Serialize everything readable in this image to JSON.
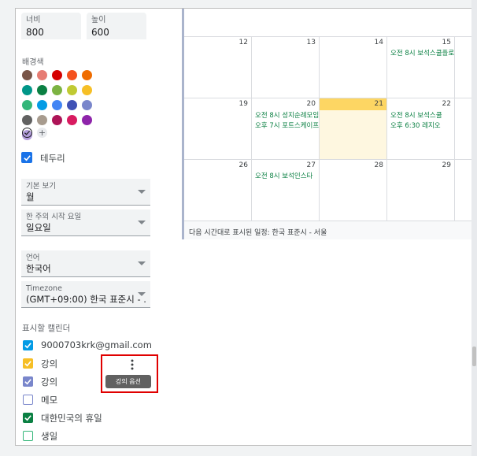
{
  "size": {
    "width_label": "너비",
    "width_value": "800",
    "height_label": "높이",
    "height_value": "600"
  },
  "background": {
    "label": "배경색",
    "colors": [
      "#795548",
      "#e67c73",
      "#d50000",
      "#f4511e",
      "#ef6c00",
      "#009688",
      "#0b8043",
      "#7cb342",
      "#c0ca33",
      "#f6bf26",
      "#33b679",
      "#039be5",
      "#4285f4",
      "#3f51b5",
      "#7986cb",
      "#616161",
      "#a79b8e",
      "#ad1457",
      "#d81b60",
      "#8e24aa",
      "#b39ddb"
    ]
  },
  "border": {
    "label": "테두리",
    "checked": true
  },
  "settings": {
    "default_view_label": "기본 보기",
    "default_view_value": "월",
    "week_start_label": "한 주의 시작 요일",
    "week_start_value": "일요일",
    "language_label": "언어",
    "language_value": "한국어",
    "timezone_label": "Timezone",
    "timezone_value": "(GMT+09:00) 한국 표준시 - ..."
  },
  "calendars": {
    "label": "표시할 캘린더",
    "items": [
      {
        "label": "9000703krk@gmail.com",
        "color": "#039be5",
        "checked": true
      },
      {
        "label": "강의",
        "color": "#f6bf26",
        "checked": true
      },
      {
        "label": "강의",
        "color": "#7986cb",
        "checked": true
      },
      {
        "label": "메모",
        "color": "#7986cb",
        "checked": false
      },
      {
        "label": "대한민국의 휴일",
        "color": "#0b8043",
        "checked": true
      },
      {
        "label": "생일",
        "color": "#33b679",
        "checked": false
      }
    ]
  },
  "tooltip": {
    "text": "강의 옵션"
  },
  "calendar_preview": {
    "days": {
      "d12": "12",
      "d13": "13",
      "d14": "14",
      "d15": "15",
      "d19": "19",
      "d20": "20",
      "d21": "21",
      "d22": "22",
      "d26": "26",
      "d27": "27",
      "d28": "28",
      "d29": "29"
    },
    "events": {
      "e15_1": "오전 8시 보석스쿨플로",
      "e20_1": "오전 8시 성지순례모임",
      "e20_2": "오후 7시 포트스케이프",
      "e22_1": "오전 8시 보석스쿨",
      "e22_2": "오후 6:30 레지오",
      "e27_1": "오전 8시 보석인스타"
    },
    "footer": "다음 시간대로 표시된 일정: 한국 표준시 - 서울"
  }
}
